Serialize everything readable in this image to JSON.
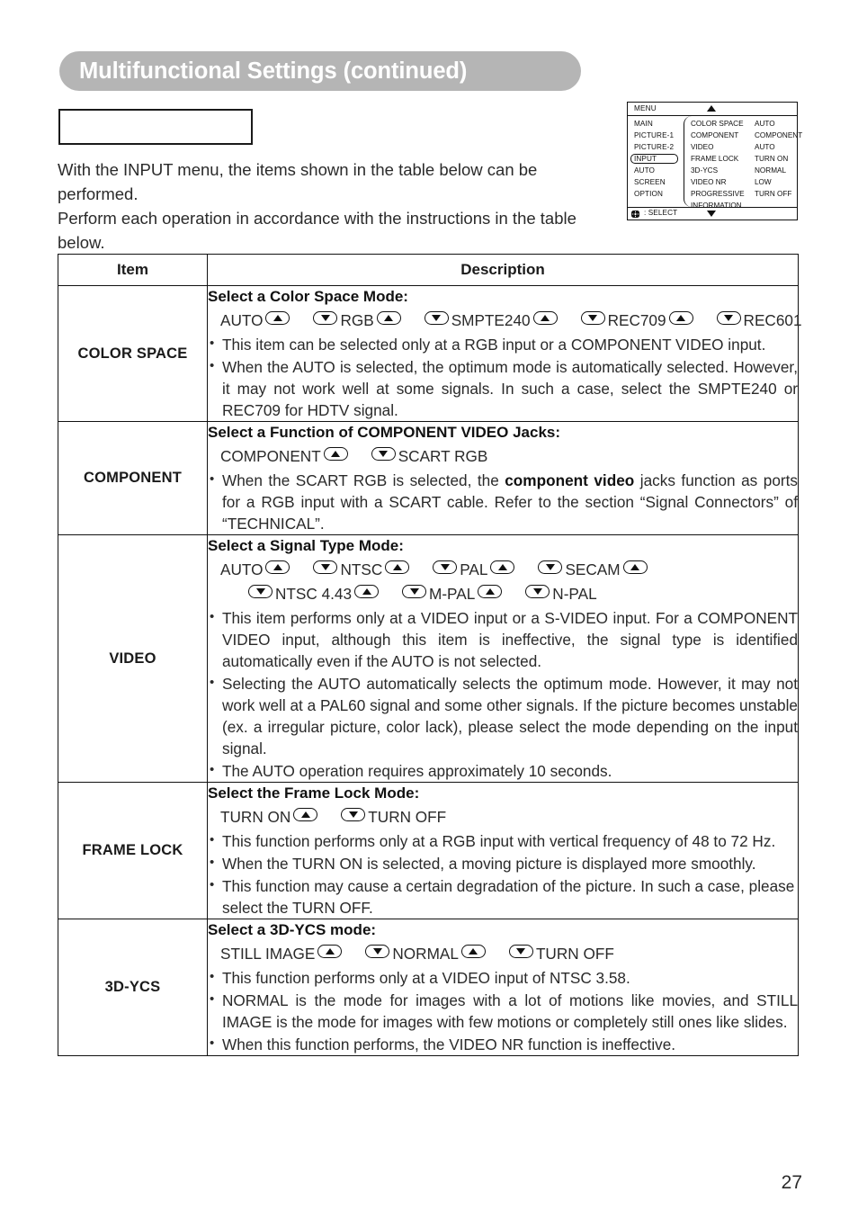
{
  "page": {
    "title": "Multifunctional Settings (continued)",
    "number": "27"
  },
  "intro": {
    "line1": "With the INPUT menu, the  items shown in the table below can be performed.",
    "line2": "Perform each operation in accordance with the instructions in the table below."
  },
  "osd": {
    "menu_label": "MENU",
    "up_arrow_icon": "triangle-up-icon",
    "down_arrow_icon": "triangle-down-icon",
    "select_icon": "cursor-pad-icon",
    "select_label": ": SELECT",
    "left_items": [
      {
        "label": "MAIN",
        "selected": false
      },
      {
        "label": "PICTURE-1",
        "selected": false
      },
      {
        "label": "PICTURE-2",
        "selected": false
      },
      {
        "label": "INPUT",
        "selected": true
      },
      {
        "label": "AUTO",
        "selected": false
      },
      {
        "label": "SCREEN",
        "selected": false
      },
      {
        "label": "OPTION",
        "selected": false
      }
    ],
    "rows": [
      {
        "name": "COLOR SPACE",
        "value": "AUTO"
      },
      {
        "name": "COMPONENT",
        "value": "COMPONENT"
      },
      {
        "name": "VIDEO",
        "value": "AUTO"
      },
      {
        "name": "FRAME LOCK",
        "value": "TURN ON"
      },
      {
        "name": "3D-YCS",
        "value": "NORMAL"
      },
      {
        "name": "VIDEO NR",
        "value": "LOW"
      },
      {
        "name": "PROGRESSIVE",
        "value": "TURN OFF"
      },
      {
        "name": "INFORMATION",
        "value": ""
      }
    ]
  },
  "table": {
    "headers": {
      "item": "Item",
      "description": "Description"
    },
    "rows": {
      "color_space": {
        "item": "COLOR SPACE",
        "heading": "Select a Color Space Mode:",
        "modes": {
          "m1": "AUTO",
          "m2": "RGB",
          "m3": "SMPTE240",
          "m4": "REC709",
          "m5": "REC601"
        },
        "bullets": {
          "b1": "This item can be selected only at a RGB input or a COMPONENT VIDEO input.",
          "b2": "When the AUTO is selected, the optimum mode is automatically selected. However, it may not work well at some signals. In such a case, select the SMPTE240 or REC709 for HDTV signal."
        }
      },
      "component": {
        "item": "COMPONENT",
        "heading": "Select a Function of COMPONENT VIDEO Jacks:",
        "modes": {
          "m1": "COMPONENT",
          "m2": "SCART RGB"
        },
        "bullets": {
          "b1_pre": "When the SCART RGB is selected, the ",
          "b1_bold": "component video",
          "b1_post": " jacks function as ports for a RGB input with a SCART cable. Refer to the section “Signal Connectors” of “TECHNICAL”."
        }
      },
      "video": {
        "item": "VIDEO",
        "heading": "Select a Signal Type Mode:",
        "modes": {
          "m1": "AUTO",
          "m2": "NTSC",
          "m3": "PAL",
          "m4": "SECAM",
          "m5": "NTSC 4.43",
          "m6": "M-PAL",
          "m7": "N-PAL"
        },
        "bullets": {
          "b1": "This item performs only at a VIDEO input or a S-VIDEO input. For a COMPONENT VIDEO input, although this item is ineffective, the signal type is identified automatically even if the AUTO is not selected.",
          "b2": "Selecting the AUTO automatically selects the optimum mode. However, it may not work well at a PAL60 signal and some other signals. If the picture becomes unstable (ex. a irregular picture, color lack), please select the mode depending on the input signal.",
          "b3": "The AUTO operation requires approximately 10 seconds."
        }
      },
      "frame_lock": {
        "item": "FRAME LOCK",
        "heading": "Select the Frame Lock Mode:",
        "modes": {
          "m1": "TURN ON",
          "m2": "TURN OFF"
        },
        "bullets": {
          "b1": "This function performs only at a RGB input with vertical frequency of 48 to 72 Hz.",
          "b2": "When the TURN ON is selected, a moving picture is displayed more smoothly.",
          "b3": "This function may cause a certain degradation of the picture. In such a case, please select the TURN OFF."
        }
      },
      "ycs_3d": {
        "item": "3D-YCS",
        "heading": "Select a 3D-YCS mode:",
        "modes": {
          "m1": "STILL IMAGE",
          "m2": "NORMAL",
          "m3": "TURN OFF"
        },
        "bullets": {
          "b1": "This function performs only at a VIDEO input of NTSC 3.58.",
          "b2": "NORMAL is the mode for images with a lot of motions like movies, and STILL IMAGE is the mode for images with few motions or completely still ones like slides.",
          "b3": "When this function performs, the VIDEO NR function is ineffective."
        }
      }
    }
  },
  "colors": {
    "title_banner": "#b5b5b5",
    "title_text": "#ffffff",
    "rule": "#111111",
    "body_text": "#2a2a2a"
  }
}
